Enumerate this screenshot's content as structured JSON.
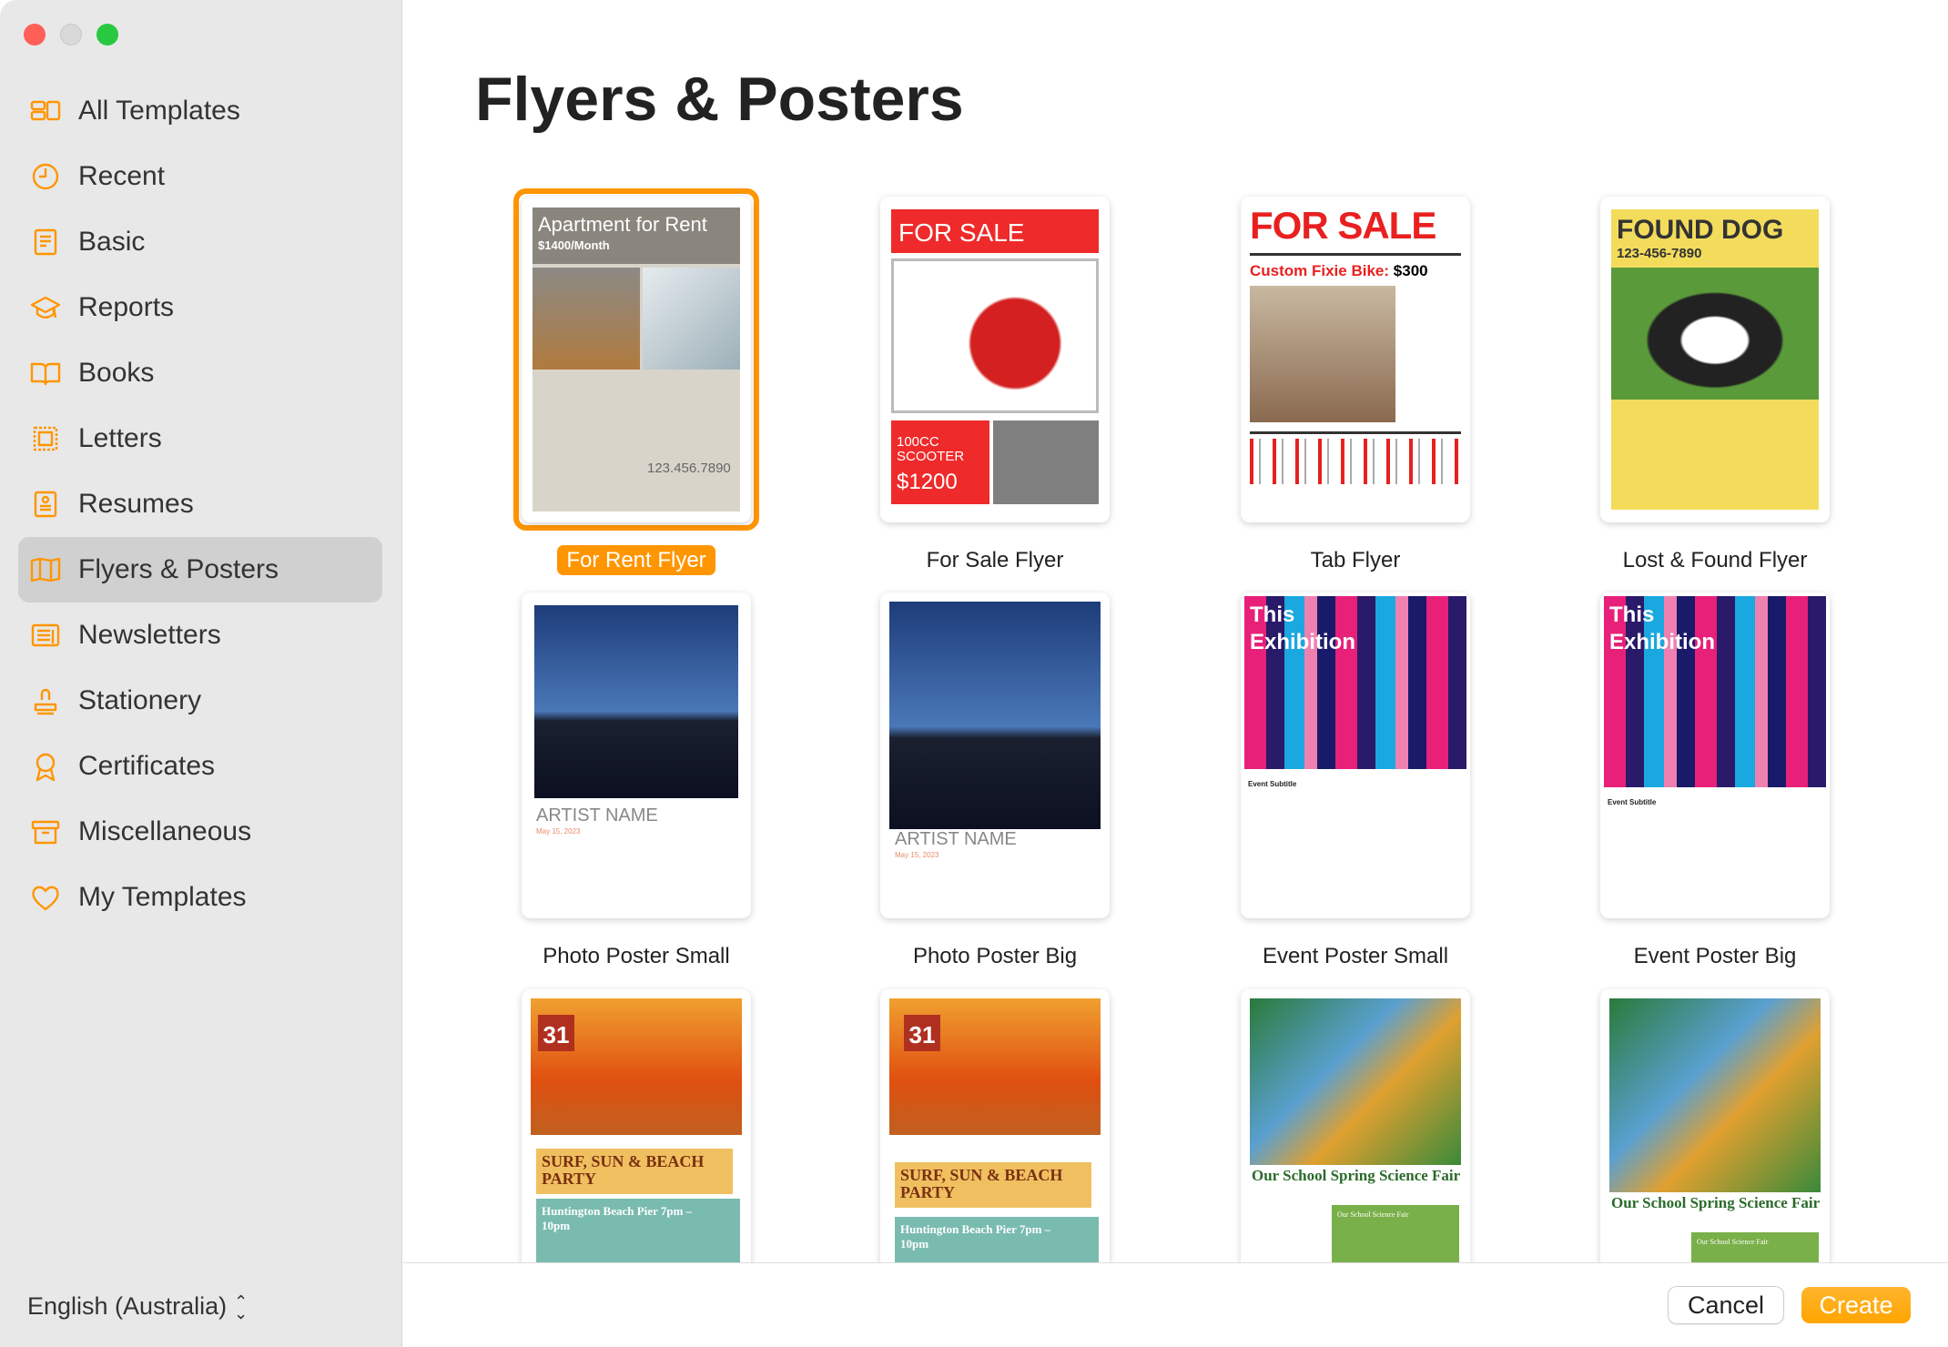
{
  "window": {
    "controls": [
      "close",
      "minimize",
      "zoom"
    ]
  },
  "sidebar": {
    "items": [
      {
        "label": "All Templates",
        "icon": "grid-icon"
      },
      {
        "label": "Recent",
        "icon": "clock-icon"
      },
      {
        "label": "Basic",
        "icon": "document-icon"
      },
      {
        "label": "Reports",
        "icon": "graduation-cap-icon"
      },
      {
        "label": "Books",
        "icon": "book-icon"
      },
      {
        "label": "Letters",
        "icon": "stamp-icon"
      },
      {
        "label": "Resumes",
        "icon": "resume-icon"
      },
      {
        "label": "Flyers & Posters",
        "icon": "open-book-icon",
        "selected": true
      },
      {
        "label": "Newsletters",
        "icon": "newspaper-icon"
      },
      {
        "label": "Stationery",
        "icon": "stamp-tool-icon"
      },
      {
        "label": "Certificates",
        "icon": "ribbon-icon"
      },
      {
        "label": "Miscellaneous",
        "icon": "box-icon"
      },
      {
        "label": "My Templates",
        "icon": "heart-icon"
      }
    ],
    "language": "English (Australia)"
  },
  "main": {
    "title": "Flyers & Posters",
    "templates": [
      {
        "label": "For Rent Flyer",
        "selected": true,
        "headline": "Apartment for Rent",
        "sub": "$1400/Month",
        "extra": "123.456.7890"
      },
      {
        "label": "For Sale Flyer",
        "headline": "FOR SALE",
        "sub": "100CC SCOOTER",
        "extra": "$1200"
      },
      {
        "label": "Tab Flyer",
        "headline": "FOR SALE",
        "sub": "Custom Fixie Bike:",
        "extra": "$300"
      },
      {
        "label": "Lost & Found Flyer",
        "headline": "FOUND DOG",
        "sub": "123-456-7890"
      },
      {
        "label": "Photo Poster Small",
        "headline": "ARTIST NAME",
        "sub": "May 15, 2023"
      },
      {
        "label": "Photo Poster Big",
        "headline": "ARTIST NAME",
        "sub": "May 15, 2023"
      },
      {
        "label": "Event Poster Small",
        "headline": "This Exhibition",
        "sub": "Event Subtitle"
      },
      {
        "label": "Event Poster Big",
        "headline": "This Exhibition",
        "sub": "Event Subtitle"
      },
      {
        "label": "",
        "headline": "SURF, SUN & BEACH PARTY",
        "sub": "Huntington Beach Pier 7pm – 10pm",
        "extra": "31"
      },
      {
        "label": "",
        "headline": "SURF, SUN & BEACH PARTY",
        "sub": "Huntington Beach Pier 7pm – 10pm",
        "extra": "31"
      },
      {
        "label": "",
        "headline": "Our School Spring Science Fair",
        "sub": "Our School Science Fair"
      },
      {
        "label": "",
        "headline": "Our School Spring Science Fair",
        "sub": "Our School Science Fair"
      }
    ]
  },
  "footer": {
    "cancel": "Cancel",
    "create": "Create"
  },
  "colors": {
    "accent": "#ff9500",
    "sidebar_bg": "#e8e8e8",
    "selected_bg": "#d0d0d0"
  }
}
